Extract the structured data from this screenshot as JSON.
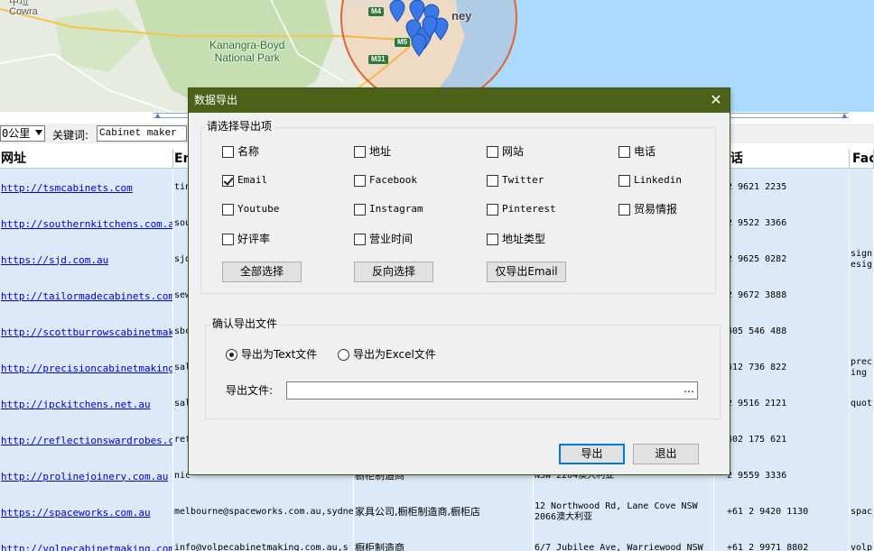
{
  "map": {
    "labels": {
      "town": "Cowra",
      "town_partial": "中垃",
      "park": "Kanangra-Boyd\nNational Park",
      "roads": [
        "M4",
        "M5",
        "M31"
      ],
      "city": "ney"
    },
    "colors": {
      "land": "#e8ebe2",
      "water": "#aadaff",
      "park": "#c5dfb2",
      "radius": "#dd6633",
      "marker": "#3a78e8"
    }
  },
  "toolbar": {
    "distance_value": "0公里",
    "keyword_label": "关键词:",
    "keyword_value": "Cabinet maker"
  },
  "table": {
    "headers": [
      "网址",
      "En",
      "",
      "",
      "话",
      "Face"
    ],
    "rows": [
      {
        "url": "http://tsmcabinets.com",
        "email": "tin",
        "category": "",
        "address": "",
        "phone": "2 9621 2235",
        "fb": ""
      },
      {
        "url": "http://southernkitchens.com.au",
        "email": "sou",
        "category": "",
        "address": "",
        "phone": "2 9522 3366",
        "fb": ""
      },
      {
        "url": "https://sjd.com.au",
        "email": "sjd",
        "category": "",
        "address": "",
        "phone": "2 9625 0282",
        "fb": "sign esig"
      },
      {
        "url": "http://tailormadecabinets.com.au",
        "email": "sew uil",
        "category": "",
        "address": "",
        "phone": "2 9672 3888",
        "fb": ""
      },
      {
        "url": "http://scottburrowscabinetmaking.com.au",
        "email": "sbc",
        "category": "",
        "address": "",
        "phone": "405 546 488",
        "fb": ""
      },
      {
        "url": "http://precisioncabinetmaking.com.au",
        "email": "sal .au",
        "category": "",
        "address": "",
        "phone": "412 736 822",
        "fb": "prec ing"
      },
      {
        "url": "http://jpckitchens.net.au",
        "email": "sal @jp",
        "category": "",
        "address": "",
        "phone": "2 9516 2121",
        "fb": "quot"
      },
      {
        "url": "http://reflectionswardrobes.com.au",
        "email": "ref",
        "category": "",
        "address": "",
        "phone": "402 175 621",
        "fb": ""
      },
      {
        "url": "http://prolinejoinery.com.au",
        "email": "nic",
        "category": "橱柜制造商",
        "address": "NSW 2204澳大利亚",
        "phone": "2 9559 3336",
        "fb": ""
      },
      {
        "url": "https://spaceworks.com.au",
        "email": "melbourne@spaceworks.com.au,sydney@spaceworks.com.au",
        "category": "家具公司,橱柜制造商,橱柜店",
        "address": "12 Northwood Rd, Lane Cove NSW 2066澳大利亚",
        "phone": "+61 2 9420 1130",
        "fb": "spac"
      },
      {
        "url": "http://volpecabinetmaking.com.au",
        "email": "info@volpecabinetmaking.com.au,s",
        "category": "橱柜制造商",
        "address": "6/7 Jubilee Ave, Warriewood NSW",
        "phone": "+61 2 9971 8802",
        "fb": "volp"
      }
    ]
  },
  "dialog": {
    "title": "数据导出",
    "close_glyph": "✕",
    "select_group_title": "请选择导出项",
    "fields": [
      {
        "label": "名称",
        "checked": false,
        "cn": true
      },
      {
        "label": "地址",
        "checked": false,
        "cn": true
      },
      {
        "label": "网站",
        "checked": false,
        "cn": true
      },
      {
        "label": "电话",
        "checked": false,
        "cn": true
      },
      {
        "label": "Email",
        "checked": true,
        "cn": false
      },
      {
        "label": "Facebook",
        "checked": false,
        "cn": false
      },
      {
        "label": "Twitter",
        "checked": false,
        "cn": false
      },
      {
        "label": "Linkedin",
        "checked": false,
        "cn": false
      },
      {
        "label": "Youtube",
        "checked": false,
        "cn": false
      },
      {
        "label": "Instagram",
        "checked": false,
        "cn": false
      },
      {
        "label": "Pinterest",
        "checked": false,
        "cn": false
      },
      {
        "label": "贸易情报",
        "checked": false,
        "cn": true
      },
      {
        "label": "好评率",
        "checked": false,
        "cn": true
      },
      {
        "label": "营业时间",
        "checked": false,
        "cn": true
      },
      {
        "label": "地址类型",
        "checked": false,
        "cn": true
      }
    ],
    "select_all_label": "全部选择",
    "invert_label": "反向选择",
    "email_only_label": "仅导出Email",
    "file_group_title": "确认导出文件",
    "radio_text_label": "导出为Text文件",
    "radio_excel_label": "导出为Excel文件",
    "selected_format": "text",
    "file_label": "导出文件:",
    "file_value": "",
    "browse_glyph": "…",
    "export_label": "导出",
    "exit_label": "退出"
  }
}
